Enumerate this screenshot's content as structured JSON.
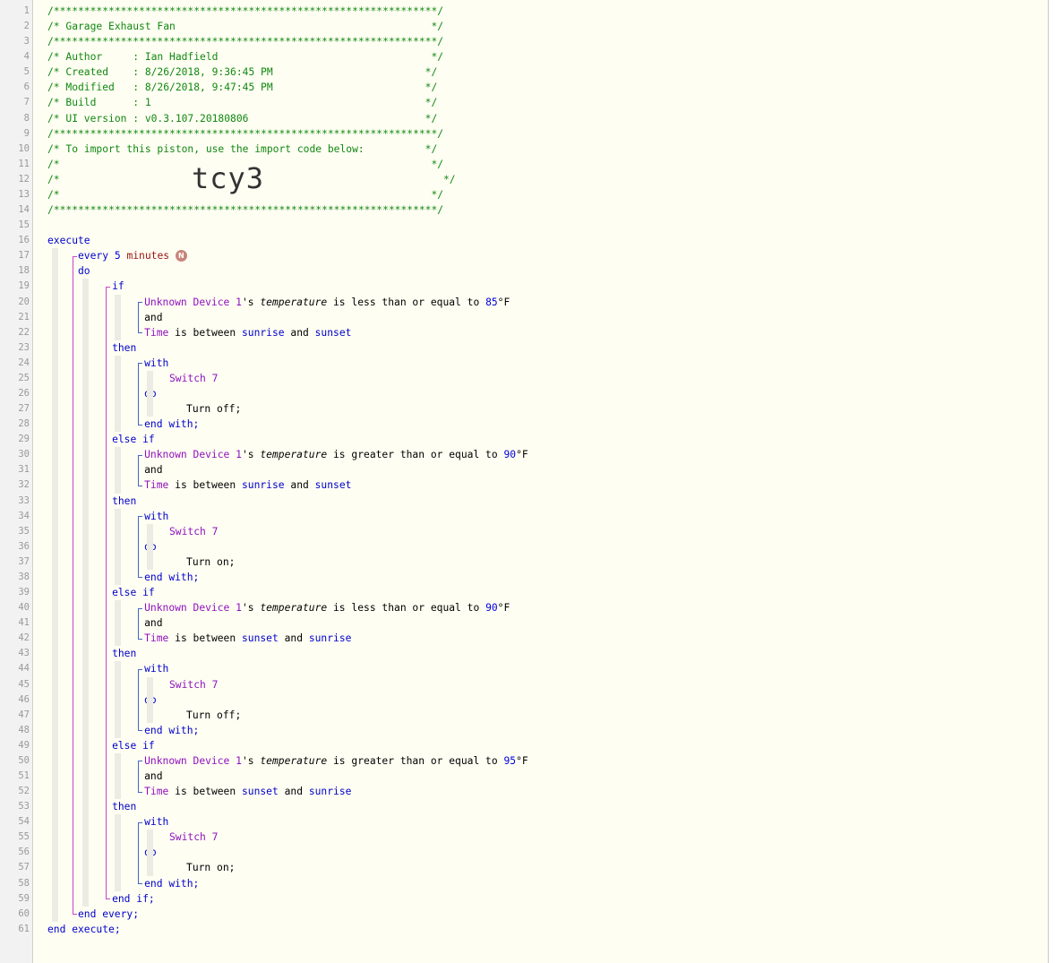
{
  "header": {
    "border": "/***************************************************************/",
    "title": "/* Garage Exhaust Fan                                          */",
    "author": "/* Author     : Ian Hadfield                                   */",
    "created": "/* Created    : 8/26/2018, 9:36:45 PM                         */",
    "modified": "/* Modified   : 8/26/2018, 9:47:45 PM                         */",
    "build": "/* Build      : 1                                             */",
    "ui_version": "/* UI version : v0.3.107.20180806                             */",
    "import_note": "/* To import this piston, use the import code below:          */",
    "blank": "/*                                                             */",
    "open": "/*",
    "close": "*/",
    "import_code": "tcy3"
  },
  "kw": {
    "execute": "execute",
    "every": "every",
    "minutes": "minutes",
    "do": "do",
    "if": "if",
    "and": "and",
    "then": "then",
    "with": "with",
    "end_with": "end with;",
    "else": "else",
    "end_if": "end if;",
    "end_every": "end every;",
    "end_execute": "end execute;",
    "is_between": "is between",
    "and_word": "and",
    "temp_suffix": "'s",
    "is": "is",
    "attr": "temperature",
    "unit": "°F"
  },
  "badge": "N",
  "timer_value": "5",
  "device": "Unknown Device 1",
  "time_label": "Time",
  "switch_name": "Switch 7",
  "blocks": [
    {
      "start": "if",
      "op": "less than or equal to",
      "value": "85",
      "from": "sunrise",
      "to": "sunset",
      "action": "Turn off;"
    },
    {
      "start": "else if",
      "op": "greater than or equal to",
      "value": "90",
      "from": "sunrise",
      "to": "sunset",
      "action": "Turn on;"
    },
    {
      "start": "else if",
      "op": "less than or equal to",
      "value": "90",
      "from": "sunset",
      "to": "sunrise",
      "action": "Turn off;"
    },
    {
      "start": "else if",
      "op": "greater than or equal to",
      "value": "95",
      "from": "sunset",
      "to": "sunrise",
      "action": "Turn on;"
    }
  ],
  "line_numbers": [
    "1",
    "2",
    "3",
    "4",
    "5",
    "6",
    "7",
    "8",
    "9",
    "10",
    "11",
    "12",
    "13",
    "14",
    "15",
    "16",
    "17",
    "18",
    "19",
    "20",
    "21",
    "22",
    "23",
    "24",
    "25",
    "26",
    "27",
    "28",
    "29",
    "30",
    "31",
    "32",
    "33",
    "34",
    "35",
    "36",
    "37",
    "38",
    "39",
    "40",
    "41",
    "42",
    "43",
    "44",
    "45",
    "46",
    "47",
    "48",
    "49",
    "50",
    "51",
    "52",
    "53",
    "54",
    "55",
    "56",
    "57",
    "58",
    "59",
    "60",
    "61"
  ],
  "colors": {
    "comment": "#118811",
    "keyword": "#0000cc",
    "device": "#9010c0",
    "number": "#0000dd",
    "timer": "#9a1111",
    "branch_line": "#cc44cc",
    "block_line": "#4466cc",
    "background": "#fefef2"
  }
}
